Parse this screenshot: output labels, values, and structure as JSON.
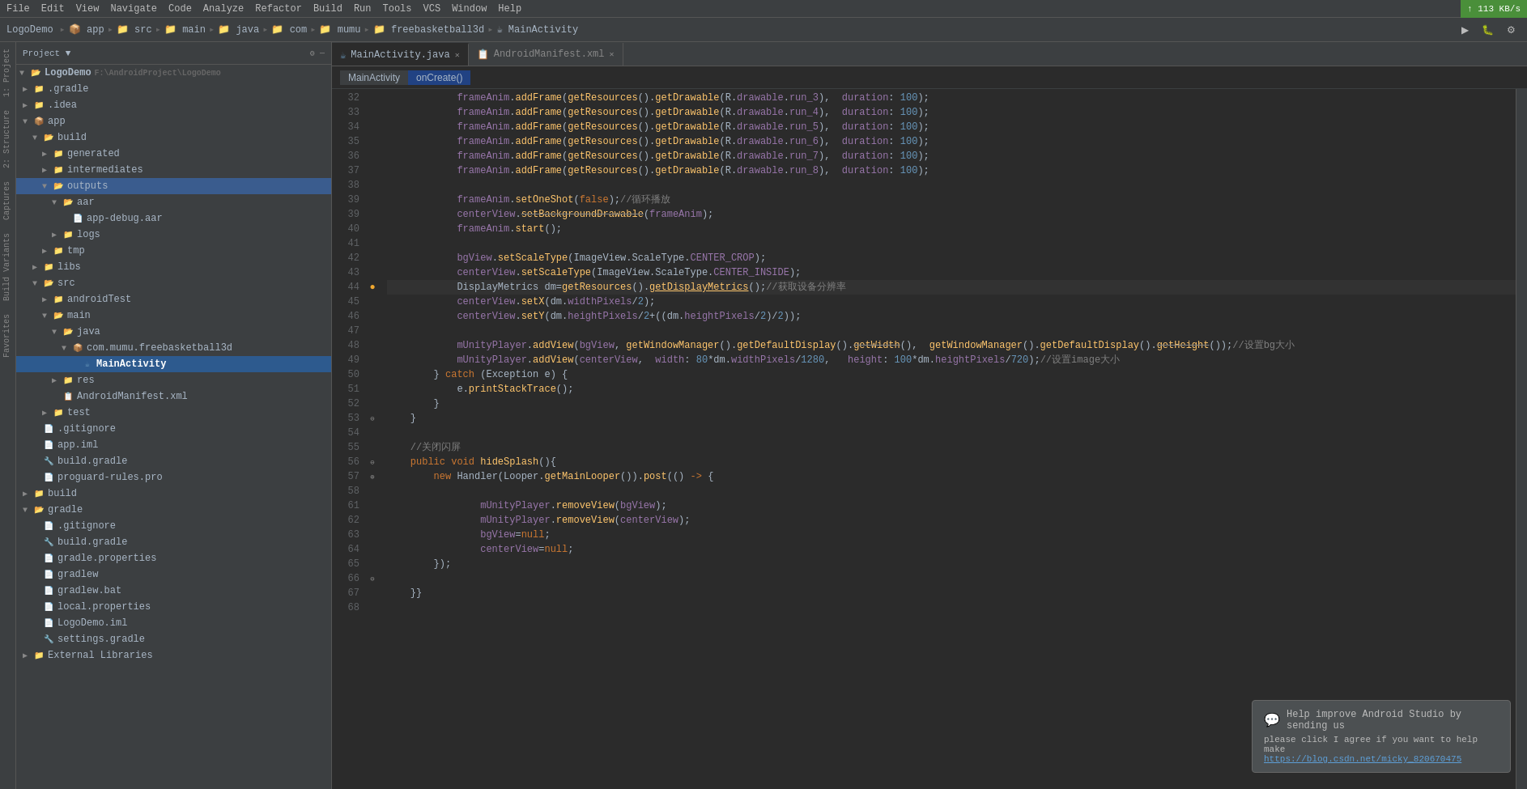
{
  "menubar": {
    "items": [
      "File",
      "Edit",
      "View",
      "Navigate",
      "Code",
      "Analyze",
      "Refactor",
      "Build",
      "Run",
      "Tools",
      "VCS",
      "Window",
      "Help"
    ]
  },
  "breadcrumb_toolbar": {
    "items": [
      "LogoDemo",
      "app",
      "src",
      "main",
      "java",
      "com",
      "mumu",
      "freebasketball3d",
      "MainActivity"
    ]
  },
  "top_right_status": "↑ 113 KB/s",
  "tabs": [
    {
      "label": "MainActivity.java",
      "active": true,
      "closable": true
    },
    {
      "label": "AndroidManifest.xml",
      "active": false,
      "closable": true
    }
  ],
  "breadcrumb_methods": [
    "MainActivity",
    "onCreate()"
  ],
  "project_panel": {
    "title": "Project",
    "tree": [
      {
        "indent": 0,
        "type": "root",
        "label": "LogoDemo",
        "path": "F:\\AndroidProject\\LogoDemo",
        "expanded": true
      },
      {
        "indent": 1,
        "type": "folder",
        "label": ".gradle",
        "expanded": false
      },
      {
        "indent": 1,
        "type": "folder",
        "label": ".idea",
        "expanded": false
      },
      {
        "indent": 1,
        "type": "folder-app",
        "label": "app",
        "expanded": true,
        "selected": false
      },
      {
        "indent": 2,
        "type": "folder",
        "label": "build",
        "expanded": true
      },
      {
        "indent": 3,
        "type": "folder",
        "label": "generated",
        "expanded": false
      },
      {
        "indent": 3,
        "type": "folder",
        "label": "intermediates",
        "expanded": false
      },
      {
        "indent": 3,
        "type": "folder",
        "label": "outputs",
        "expanded": true,
        "highlighted": true
      },
      {
        "indent": 4,
        "type": "folder",
        "label": "aar",
        "expanded": true
      },
      {
        "indent": 5,
        "type": "file",
        "label": "app-debug.aar"
      },
      {
        "indent": 4,
        "type": "folder",
        "label": "logs",
        "expanded": false
      },
      {
        "indent": 3,
        "type": "folder",
        "label": "tmp",
        "expanded": false
      },
      {
        "indent": 2,
        "type": "folder",
        "label": "libs",
        "expanded": false
      },
      {
        "indent": 2,
        "type": "folder",
        "label": "src",
        "expanded": true
      },
      {
        "indent": 3,
        "type": "folder",
        "label": "androidTest",
        "expanded": false
      },
      {
        "indent": 3,
        "type": "folder",
        "label": "main",
        "expanded": true
      },
      {
        "indent": 4,
        "type": "folder",
        "label": "java",
        "expanded": true
      },
      {
        "indent": 5,
        "type": "package",
        "label": "com.mumu.freebasketball3d",
        "expanded": true
      },
      {
        "indent": 6,
        "type": "java",
        "label": "MainActivity",
        "selected": true
      },
      {
        "indent": 4,
        "type": "folder",
        "label": "res",
        "expanded": false
      },
      {
        "indent": 4,
        "type": "xml",
        "label": "AndroidManifest.xml"
      },
      {
        "indent": 3,
        "type": "folder",
        "label": "test",
        "expanded": false
      },
      {
        "indent": 2,
        "type": "file",
        "label": ".gitignore"
      },
      {
        "indent": 2,
        "type": "file",
        "label": "app.iml"
      },
      {
        "indent": 2,
        "type": "gradle",
        "label": "build.gradle"
      },
      {
        "indent": 2,
        "type": "file",
        "label": "proguard-rules.pro"
      },
      {
        "indent": 1,
        "type": "folder",
        "label": "build",
        "expanded": false
      },
      {
        "indent": 1,
        "type": "folder",
        "label": "gradle",
        "expanded": true
      },
      {
        "indent": 2,
        "type": "file",
        "label": ".gitignore"
      },
      {
        "indent": 2,
        "type": "gradle",
        "label": "build.gradle"
      },
      {
        "indent": 2,
        "type": "file",
        "label": "gradle.properties"
      },
      {
        "indent": 2,
        "type": "file",
        "label": "gradlew"
      },
      {
        "indent": 2,
        "type": "file",
        "label": "gradlew.bat"
      },
      {
        "indent": 2,
        "type": "file",
        "label": "local.properties"
      },
      {
        "indent": 2,
        "type": "file",
        "label": "LogoDemo.iml"
      },
      {
        "indent": 2,
        "type": "gradle",
        "label": "settings.gradle"
      },
      {
        "indent": 1,
        "type": "folder",
        "label": "External Libraries",
        "expanded": false
      }
    ]
  },
  "code": {
    "lines": [
      {
        "num": 32,
        "content": "            frameAnim.addFrame(getResources().getDrawable(R.drawable.run_3),  duration: 100);"
      },
      {
        "num": 33,
        "content": "            frameAnim.addFrame(getResources().getDrawable(R.drawable.run_4),  duration: 100);"
      },
      {
        "num": 34,
        "content": "            frameAnim.addFrame(getResources().getDrawable(R.drawable.run_5),  duration: 100);"
      },
      {
        "num": 35,
        "content": "            frameAnim.addFrame(getResources().getDrawable(R.drawable.run_6),  duration: 100);"
      },
      {
        "num": 36,
        "content": "            frameAnim.addFrame(getResources().getDrawable(R.drawable.run_7),  duration: 100);"
      },
      {
        "num": 37,
        "content": "            frameAnim.addFrame(getResources().getDrawable(R.drawable.run_8),  duration: 100);"
      },
      {
        "num": 38,
        "content": ""
      },
      {
        "num": 39,
        "content": "            frameAnim.setOneShot(false);//循环播放"
      },
      {
        "num": 39,
        "content": "            centerView.setBackgroundDrawable(frameAnim);"
      },
      {
        "num": 40,
        "content": "            frameAnim.start();"
      },
      {
        "num": 41,
        "content": ""
      },
      {
        "num": 42,
        "content": "            bgView.setScaleType(ImageView.ScaleType.CENTER_CROP);"
      },
      {
        "num": 43,
        "content": "            centerView.setScaleType(ImageView.ScaleType.CENTER_INSIDE);"
      },
      {
        "num": 44,
        "content": "            DisplayMetrics dm=getResources().getDisplayMetrics();//获取设备分辨率"
      },
      {
        "num": 45,
        "content": "            centerView.setX(dm.widthPixels/2);"
      },
      {
        "num": 46,
        "content": "            centerView.setY(dm.heightPixels/2+((dm.heightPixels/2)/2));"
      },
      {
        "num": 47,
        "content": ""
      },
      {
        "num": 48,
        "content": "            mUnityPlayer.addView(bgView, getWindowManager().getDefaultDisplay().getWidth(),  getWindowManager().getDefaultDisplay().getHeight());//设置bg大小"
      },
      {
        "num": 49,
        "content": "            mUnityPlayer.addView(centerView,  width: 80*dm.widthPixels/1280,   height: 100*dm.heightPixels/720);//设置image大小"
      },
      {
        "num": 50,
        "content": "        } catch (Exception e) {"
      },
      {
        "num": 51,
        "content": "            e.printStackTrace();"
      },
      {
        "num": 52,
        "content": "        }"
      },
      {
        "num": 53,
        "content": "    }"
      },
      {
        "num": 54,
        "content": ""
      },
      {
        "num": 55,
        "content": "    //关闭闪屏"
      },
      {
        "num": 56,
        "content": "    public void hideSplash(){"
      },
      {
        "num": 57,
        "content": "        new Handler(Looper.getMainLooper()).post(() -> {"
      },
      {
        "num": 58,
        "content": ""
      },
      {
        "num": 61,
        "content": "                mUnityPlayer.removeView(bgView);"
      },
      {
        "num": 62,
        "content": "                mUnityPlayer.removeView(centerView);"
      },
      {
        "num": 63,
        "content": "                bgView=null;"
      },
      {
        "num": 64,
        "content": "                centerView=null;"
      },
      {
        "num": 65,
        "content": "        });"
      },
      {
        "num": 66,
        "content": ""
      },
      {
        "num": 67,
        "content": "    }}"
      },
      {
        "num": 68,
        "content": ""
      }
    ]
  },
  "notification": {
    "title": "Help improve Android Studio by sending us",
    "body": "please click I agree if you want to help make",
    "link_text": "https://blog.csdn.net/micky_820670475",
    "icon": "💬"
  },
  "side_panels": {
    "left_labels": [
      "Project",
      "Structure",
      "Captures",
      "Build Variants",
      "Favorites"
    ]
  }
}
